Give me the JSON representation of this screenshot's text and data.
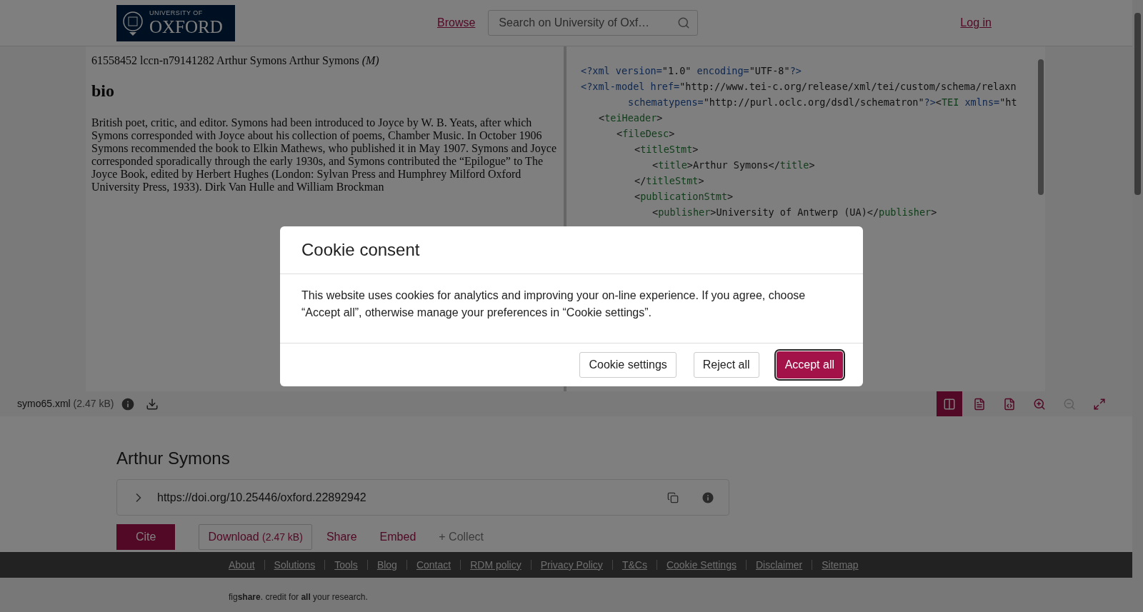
{
  "header": {
    "logo": {
      "line1": "UNIVERSITY OF",
      "line2": "OXFORD"
    },
    "nav_link": "Browse",
    "search": {
      "placeholder": "Search on University of Oxf…"
    },
    "login": "Log in"
  },
  "viewer": {
    "preview": {
      "heading": "61558452 lccn-n79141282 Arthur Symons Arthur Symons *(M)*",
      "section_title": "bio",
      "paragraph": "British poet, critic, and editor. Symons had been introduced to Joyce by W. B. Yeats, after which Symons corresponded with Joyce about his collection of poems, Chamber Music. In October 1906 Symons recommended the book to Elkin Mathews, who published it in May 1907. Symons and Joyce corresponded sporadically through the early 1930s, and Symons contributed the “Epilogue” to The Joyce Book, edited by Herbert Hughes (London: Sylvan Press and Humphrey Milford Oxford University Press, 1933). Dirk Van Hulle and William Brockman"
    },
    "xml_lines": [
      {
        "kind": "line",
        "tokens": [
          {
            "kind": "decl",
            "text": "<?xml version="
          },
          {
            "kind": "value",
            "text": "\"1.0\""
          },
          {
            "kind": "decl",
            "text": " encoding="
          },
          {
            "kind": "value",
            "text": "\"UTF-8\""
          },
          {
            "kind": "decl",
            "text": "?>"
          }
        ]
      },
      {
        "kind": "line",
        "tokens": [
          {
            "kind": "decl",
            "text": "<?xml-model href="
          },
          {
            "kind": "value",
            "text": "\"http://www.tei-c.org/release/xml/tei/custom/schema/relaxn"
          }
        ]
      },
      {
        "kind": "continuation",
        "tokens": [
          {
            "kind": "decl",
            "text": "schematypens="
          },
          {
            "kind": "value",
            "text": "\"http://purl.oclc.org/dsdl/schematron\""
          },
          {
            "kind": "decl",
            "text": "?>"
          },
          {
            "kind": "bracket",
            "text": "<"
          },
          {
            "kind": "tag",
            "text": "TEI"
          },
          {
            "kind": "decl",
            "text": " xmlns="
          },
          {
            "kind": "value",
            "text": "\"ht"
          }
        ],
        "children": [
          {
            "tokens": [
              {
                "kind": "bracket",
                "text": "<"
              },
              {
                "kind": "tag",
                "text": "teiHeader"
              },
              {
                "kind": "bracket",
                "text": ">"
              }
            ],
            "children": [
              {
                "tokens": [
                  {
                    "kind": "bracket",
                    "text": "<"
                  },
                  {
                    "kind": "tag",
                    "text": "fileDesc"
                  },
                  {
                    "kind": "bracket",
                    "text": ">"
                  }
                ],
                "children": [
                  {
                    "tokens": [
                      {
                        "kind": "bracket",
                        "text": "<"
                      },
                      {
                        "kind": "tag",
                        "text": "titleStmt"
                      },
                      {
                        "kind": "bracket",
                        "text": ">"
                      }
                    ],
                    "children": [
                      {
                        "tokens": [
                          {
                            "kind": "bracket",
                            "text": "<"
                          },
                          {
                            "kind": "tag",
                            "text": "title"
                          },
                          {
                            "kind": "bracket",
                            "text": ">"
                          },
                          {
                            "kind": "text",
                            "text": "Arthur Symons"
                          },
                          {
                            "kind": "bracket",
                            "text": "</"
                          },
                          {
                            "kind": "tag",
                            "text": "title"
                          },
                          {
                            "kind": "bracket",
                            "text": ">"
                          }
                        ]
                      }
                    ]
                  },
                  {
                    "tokens": [
                      {
                        "kind": "bracket",
                        "text": "</"
                      },
                      {
                        "kind": "tag",
                        "text": "titleStmt"
                      },
                      {
                        "kind": "bracket",
                        "text": ">"
                      }
                    ]
                  },
                  {
                    "tokens": [
                      {
                        "kind": "bracket",
                        "text": "<"
                      },
                      {
                        "kind": "tag",
                        "text": "publicationStmt"
                      },
                      {
                        "kind": "bracket",
                        "text": ">"
                      }
                    ],
                    "children": [
                      {
                        "tokens": [
                          {
                            "kind": "bracket",
                            "text": "<"
                          },
                          {
                            "kind": "tag",
                            "text": "publisher"
                          },
                          {
                            "kind": "bracket",
                            "text": ">"
                          },
                          {
                            "kind": "text",
                            "text": "University of Antwerp (UA)"
                          },
                          {
                            "kind": "bracket",
                            "text": "</"
                          },
                          {
                            "kind": "tag",
                            "text": "publisher"
                          },
                          {
                            "kind": "bracket",
                            "text": ">"
                          }
                        ]
                      }
                    ]
                  }
                ]
              }
            ]
          }
        ]
      }
    ]
  },
  "toolbar": {
    "file_name": "symo65.xml",
    "file_size": "(2.47 kB)",
    "view_buttons": [
      {
        "kind": "split",
        "selected": true,
        "disabled": false
      },
      {
        "kind": "text",
        "selected": false,
        "disabled": false
      },
      {
        "kind": "xml",
        "selected": false,
        "disabled": false
      },
      {
        "kind": "zoom-in",
        "selected": false,
        "disabled": false
      },
      {
        "kind": "zoom-out",
        "selected": false,
        "disabled": true
      },
      {
        "kind": "fullscreen",
        "selected": false,
        "disabled": false
      }
    ]
  },
  "item": {
    "title": "Arthur Symons",
    "doi": "https://doi.org/10.25446/oxford.22892942",
    "actions": [
      {
        "kind": "primary",
        "label": "Cite"
      },
      {
        "kind": "outline",
        "label": "Download",
        "size": "(2.47 kB)"
      },
      {
        "kind": "link",
        "label": "Share"
      },
      {
        "kind": "link",
        "label": "Embed"
      },
      {
        "kind": "muted",
        "label": "+ Collect"
      }
    ]
  },
  "footer": {
    "links": [
      "About",
      "Solutions",
      "Tools",
      "Blog",
      "Contact",
      "RDM policy",
      "Privacy Policy",
      "T&Cs",
      "Cookie Settings",
      "Disclaimer",
      "Sitemap"
    ],
    "tagline": "fig**share**. credit for **all** your research."
  },
  "cookie_modal": {
    "title": "Cookie consent",
    "body": "This website uses cookies for analytics and improving your on-line experience. If you agree, choose “Accept all”, otherwise manage your preferences in “Cookie settings”.",
    "buttons": [
      {
        "kind": "secondary",
        "label": "Cookie settings"
      },
      {
        "kind": "secondary",
        "label": "Reject all"
      },
      {
        "kind": "primary",
        "label": "Accept all"
      }
    ]
  }
}
